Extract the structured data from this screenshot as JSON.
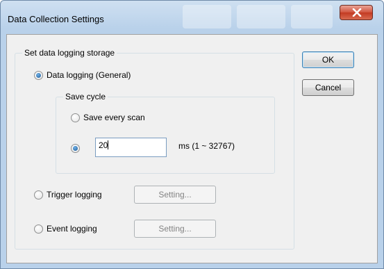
{
  "window": {
    "title": "Data Collection Settings",
    "close_label": "close"
  },
  "storage_group": {
    "legend": "Set data logging storage",
    "general_label": "Data logging (General)",
    "trigger_label": "Trigger logging",
    "event_label": "Event logging",
    "trigger_setting_label": "Setting...",
    "event_setting_label": "Setting..."
  },
  "save_cycle": {
    "legend": "Save cycle",
    "every_scan_label": "Save every scan",
    "interval_value": "20",
    "interval_unit": "ms (1 ~ 32767)"
  },
  "buttons": {
    "ok_label": "OK",
    "cancel_label": "Cancel"
  },
  "state": {
    "general_checked": true,
    "custom_interval_checked": true
  },
  "colors": {
    "titlebar": "#b9d1ea",
    "close_button": "#c23a22",
    "dialog_background": "#f0f0f0",
    "radio_checked": "#1e5a96"
  }
}
